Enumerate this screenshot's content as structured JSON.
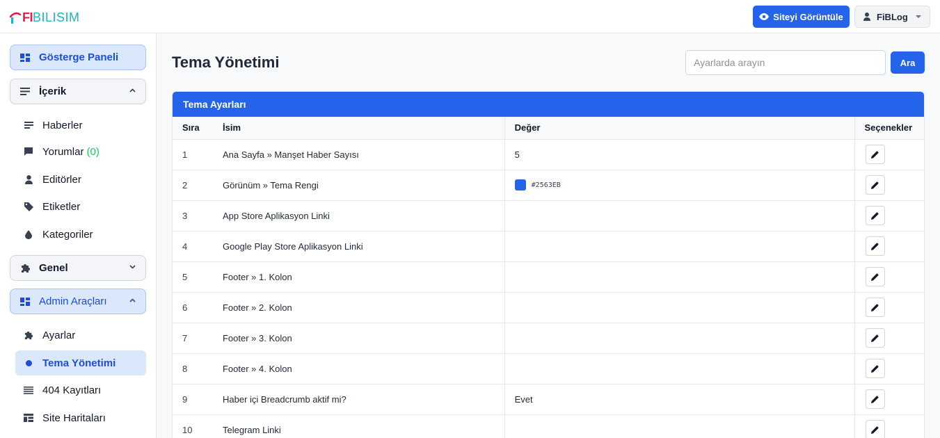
{
  "brand": {
    "logo_fi": "FI",
    "logo_rest": "BILISIM"
  },
  "header": {
    "view_site": "Siteyi Görüntüle",
    "user": "FiBLog"
  },
  "sidebar": {
    "dashboard": "Gösterge Paneli",
    "content_group": "İçerik",
    "content_items": [
      {
        "label": "Haberler"
      },
      {
        "label": "Yorumlar",
        "count": "(0)"
      },
      {
        "label": "Editörler"
      },
      {
        "label": "Etiketler"
      },
      {
        "label": "Kategoriler"
      }
    ],
    "general_group": "Genel",
    "admin_group": "Admin Araçları",
    "admin_items": [
      {
        "label": "Ayarlar"
      },
      {
        "label": "Tema Yönetimi"
      },
      {
        "label": "404 Kayıtları"
      },
      {
        "label": "Site Haritaları"
      }
    ]
  },
  "main": {
    "title": "Tema Yönetimi",
    "search": {
      "placeholder": "Ayarlarda arayın",
      "button": "Ara"
    },
    "card_title": "Tema Ayarları",
    "columns": [
      "Sıra",
      "İsim",
      "Değer",
      "Seçenekler"
    ],
    "rows": [
      {
        "idx": "1",
        "name": "Ana Sayfa » Manşet Haber Sayısı",
        "value": "5"
      },
      {
        "idx": "2",
        "name": "Görünüm » Tema Rengi",
        "value": "#2563EB",
        "swatch": "#2563eb"
      },
      {
        "idx": "3",
        "name": "App Store Aplikasyon Linki",
        "value": ""
      },
      {
        "idx": "4",
        "name": "Google Play Store Aplikasyon Linki",
        "value": ""
      },
      {
        "idx": "5",
        "name": "Footer » 1. Kolon",
        "value": ""
      },
      {
        "idx": "6",
        "name": "Footer » 2. Kolon",
        "value": ""
      },
      {
        "idx": "7",
        "name": "Footer » 3. Kolon",
        "value": ""
      },
      {
        "idx": "8",
        "name": "Footer » 4. Kolon",
        "value": ""
      },
      {
        "idx": "9",
        "name": "Haber içi Breadcrumb aktif mi?",
        "value": "Evet"
      },
      {
        "idx": "10",
        "name": "Telegram Linki",
        "value": ""
      }
    ]
  },
  "colors": {
    "accent": "#2563eb",
    "active_bg": "#dbe7fb",
    "count_green": "#22c55e"
  }
}
